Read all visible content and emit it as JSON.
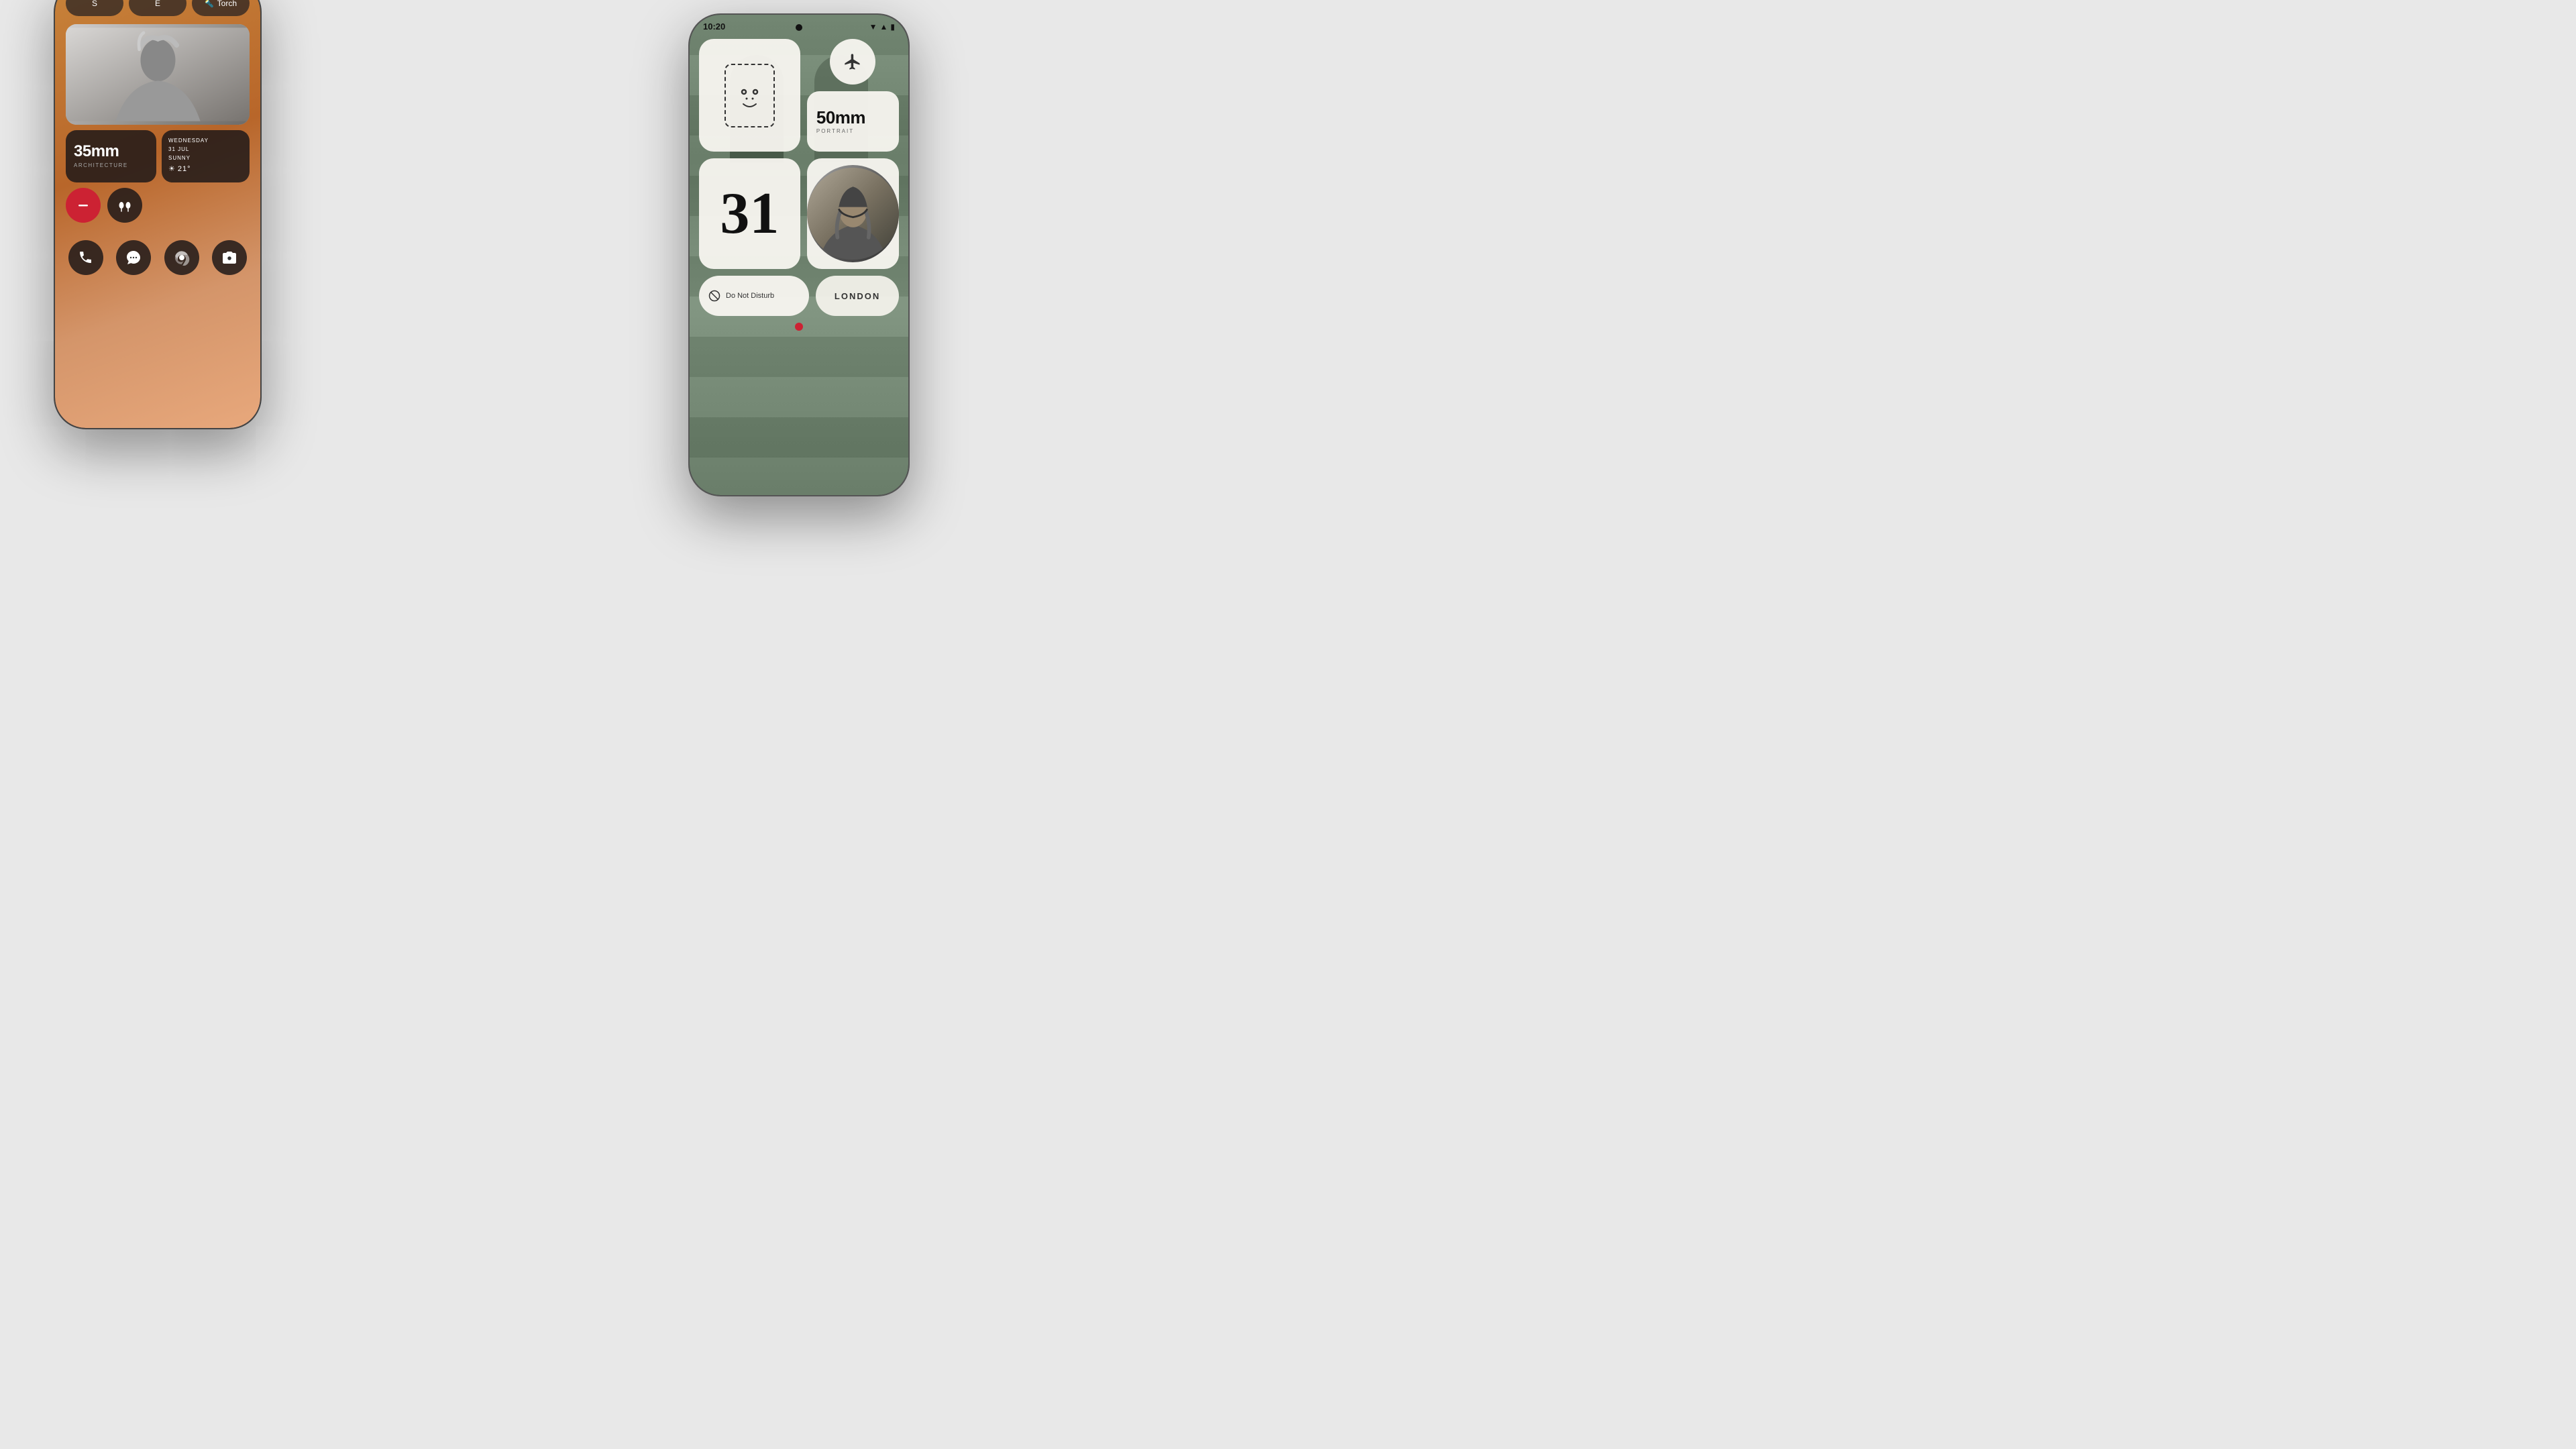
{
  "background": "#e8e8e8",
  "left_phone": {
    "top_buttons": [
      {
        "label": "S",
        "id": "btn-s"
      },
      {
        "label": "E",
        "id": "btn-e"
      },
      {
        "label": "Torch",
        "id": "btn-torch",
        "has_icon": true
      }
    ],
    "widget_35mm": {
      "title": "35mm",
      "subtitle": "ARCHITECTURE"
    },
    "widget_weather": {
      "day": "WEDNESDAY",
      "date": "31 JUL",
      "condition": "SUNNY",
      "temp": "21°"
    },
    "circle_buttons": [
      {
        "type": "red",
        "icon": "minus"
      },
      {
        "type": "dark",
        "icon": "airpods"
      }
    ],
    "dock_apps": [
      {
        "name": "phone",
        "icon": "📞"
      },
      {
        "name": "messages",
        "icon": "💬"
      },
      {
        "name": "chrome",
        "icon": "🌐"
      },
      {
        "name": "camera",
        "icon": "📷"
      }
    ]
  },
  "right_phone": {
    "status_bar": {
      "time": "10:20",
      "wifi": true,
      "signal": true,
      "battery": true
    },
    "widgets": [
      {
        "id": "face-id",
        "type": "face_id"
      },
      {
        "id": "airplane",
        "type": "airplane"
      },
      {
        "id": "50mm",
        "type": "lens",
        "title": "50mm",
        "subtitle": "PORTRAIT"
      },
      {
        "id": "date-31",
        "type": "date",
        "value": "31"
      },
      {
        "id": "photo-person",
        "type": "photo_circle"
      },
      {
        "id": "dnd",
        "type": "do_not_disturb",
        "label": "Do Not Disturb"
      },
      {
        "id": "london",
        "type": "city",
        "label": "LONDON"
      }
    ]
  }
}
